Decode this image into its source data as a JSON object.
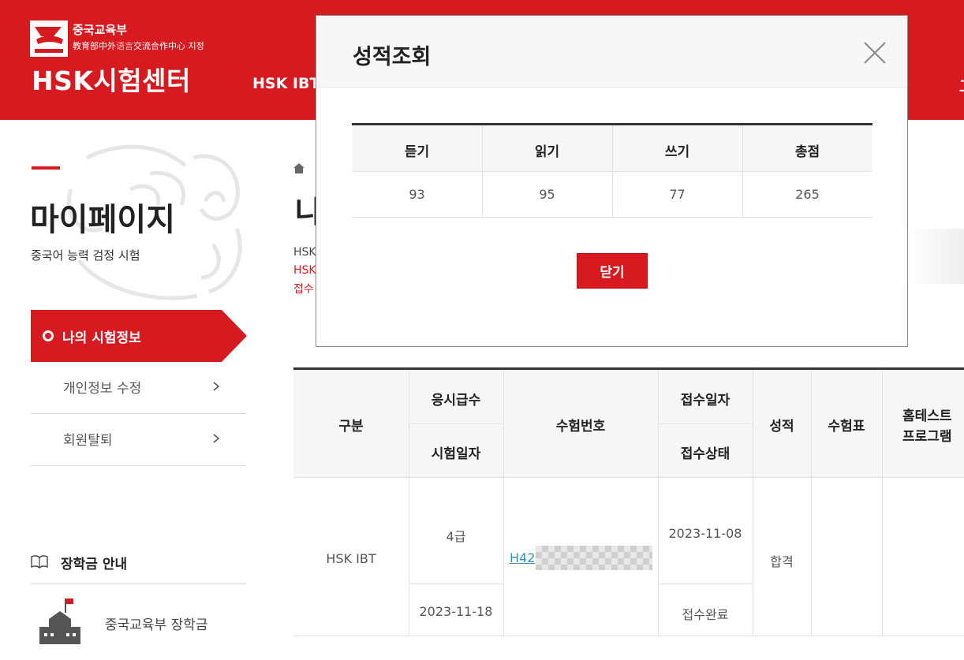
{
  "colors": {
    "brand": "#d71920",
    "link": "#3a8fb7",
    "header_text": "#ffffff"
  },
  "header": {
    "logo_line1": "중국교육부",
    "logo_line2_a": "教育部中外",
    "logo_line2_b": "语言",
    "logo_line2_c": "交流合作中心 지정",
    "logo_main": "HSK시험센터",
    "nav_visible": "HSK IBT",
    "nav_right_fragment": "고"
  },
  "sidebar": {
    "title": "마이페이지",
    "subtitle": "중국어 능력 검정 시험",
    "active_item": "나의 시험정보",
    "items": [
      {
        "label": "개인정보 수정"
      },
      {
        "label": "회원탈퇴"
      }
    ],
    "scholarship_title": "장학금 안내",
    "scholarship_item": "중국교육부 장학금"
  },
  "main": {
    "title_fragment": "나",
    "info_fragments": [
      "HSK",
      "HSK",
      "접수"
    ],
    "table": {
      "headers": {
        "category": "구분",
        "level": "응시급수",
        "exam_date": "시험일자",
        "exam_number": "수험번호",
        "apply_date": "접수일자",
        "apply_status": "접수상태",
        "score": "성적",
        "ticket": "수험표",
        "hometest_1": "홈테스트",
        "hometest_2": "프로그램"
      },
      "row": {
        "category": "HSK IBT",
        "level": "4급",
        "exam_date": "2023-11-18",
        "exam_number": "H42",
        "apply_date": "2023-11-08",
        "apply_status": "접수완료",
        "score": "합격"
      }
    }
  },
  "modal": {
    "title": "성적조회",
    "headers": [
      "듣기",
      "읽기",
      "쓰기",
      "총점"
    ],
    "scores": [
      "93",
      "95",
      "77",
      "265"
    ],
    "close_button": "닫기"
  }
}
